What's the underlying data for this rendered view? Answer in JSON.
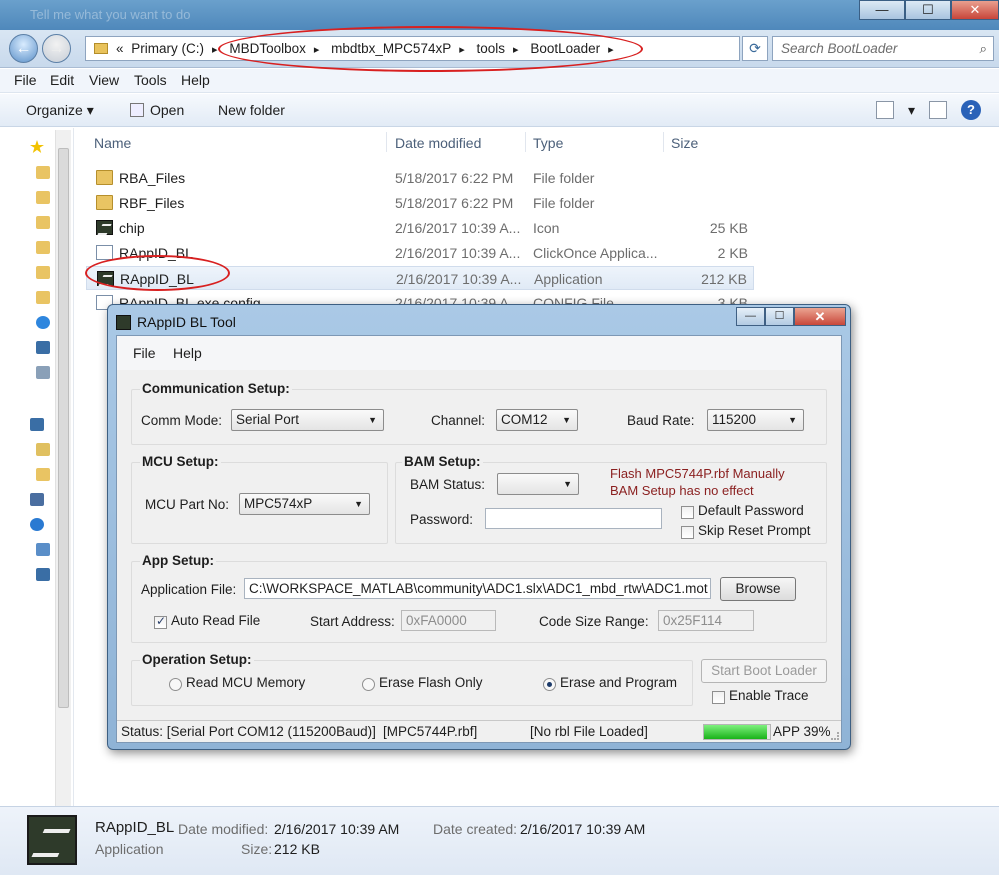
{
  "explorer": {
    "ghost_title": "Tell me what you want to do",
    "caption_buttons": [
      "—",
      "☐",
      "✕"
    ],
    "address": {
      "prefix": "«",
      "crumbs": [
        "Primary (C:)",
        "MBDToolbox",
        "mbdtbx_MPC574xP",
        "tools",
        "BootLoader"
      ],
      "separator": "▸"
    },
    "refresh_icon": "⟳",
    "search": {
      "placeholder": "Search BootLoader",
      "icon": "⌕"
    },
    "menu": [
      "File",
      "Edit",
      "View",
      "Tools",
      "Help"
    ],
    "commands": {
      "organize": "Organize ▾",
      "open": "Open",
      "new_folder": "New folder",
      "view_arrow": "▾",
      "help_glyph": "?"
    },
    "columns": [
      "Name",
      "Date modified",
      "Type",
      "Size"
    ],
    "files": [
      {
        "name": "RBA_Files",
        "date": "5/18/2017 6:22 PM",
        "type": "File folder",
        "size": "",
        "icon": "folder-icon"
      },
      {
        "name": "RBF_Files",
        "date": "5/18/2017 6:22 PM",
        "type": "File folder",
        "size": "",
        "icon": "folder-icon"
      },
      {
        "name": "chip",
        "date": "2/16/2017 10:39 A...",
        "type": "Icon",
        "size": "25 KB",
        "icon": "app-icon"
      },
      {
        "name": "RAppID_BL",
        "date": "2/16/2017 10:39 A...",
        "type": "ClickOnce Applica...",
        "size": "2 KB",
        "icon": "document-icon"
      },
      {
        "name": "RAppID_BL",
        "date": "2/16/2017 10:39 A...",
        "type": "Application",
        "size": "212 KB",
        "icon": "app-icon"
      },
      {
        "name": "RAppID_BL.exe.config",
        "date": "2/16/2017 10:39 A...",
        "type": "CONFIG File",
        "size": "3 KB",
        "icon": "document-icon"
      }
    ],
    "details": {
      "name": "RAppID_BL",
      "type": "Application",
      "date_modified_label": "Date modified:",
      "date_modified": "2/16/2017 10:39 AM",
      "date_created_label": "Date created:",
      "date_created": "2/16/2017 10:39 AM",
      "size_label": "Size:",
      "size": "212 KB"
    }
  },
  "dialog": {
    "title": "RAppID BL Tool",
    "caption_buttons": [
      "—",
      "☐",
      "✕"
    ],
    "menu": [
      "File",
      "Help"
    ],
    "comm": {
      "title": "Communication Setup:",
      "mode_label": "Comm Mode:",
      "mode_value": "Serial Port",
      "channel_label": "Channel:",
      "channel_value": "COM12",
      "baud_label": "Baud Rate:",
      "baud_value": "115200"
    },
    "mcu": {
      "title": "MCU Setup:",
      "part_label": "MCU Part No:",
      "part_value": "MPC574xP"
    },
    "bam": {
      "title": "BAM Setup:",
      "status_label": "BAM Status:",
      "status_value": "",
      "password_label": "Password:",
      "password_value": "",
      "warning_line1": "Flash MPC5744P.rbf Manually",
      "warning_line2": "BAM Setup has no effect",
      "default_password": "Default Password",
      "skip_reset": "Skip Reset Prompt"
    },
    "app": {
      "title": "App Setup:",
      "file_label": "Application File:",
      "file_value": "C:\\WORKSPACE_MATLAB\\community\\ADC1.slx\\ADC1_mbd_rtw\\ADC1.mot",
      "browse": "Browse",
      "auto_read": "Auto Read File",
      "start_label": "Start Address:",
      "start_value": "0xFA0000",
      "range_label": "Code Size Range:",
      "range_value": "0x25F114"
    },
    "op": {
      "title": "Operation Setup:",
      "read": "Read MCU Memory",
      "erase": "Erase Flash Only",
      "erase_program": "Erase and Program",
      "start": "Start Boot Loader",
      "trace": "Enable Trace"
    },
    "status": {
      "text": "Status: [Serial Port COM12 (115200Baud)]",
      "rbf": "[MPC5744P.rbf]",
      "rbl": "[No rbl File Loaded]",
      "app_label": "APP 39%",
      "progress": 0.95
    }
  }
}
